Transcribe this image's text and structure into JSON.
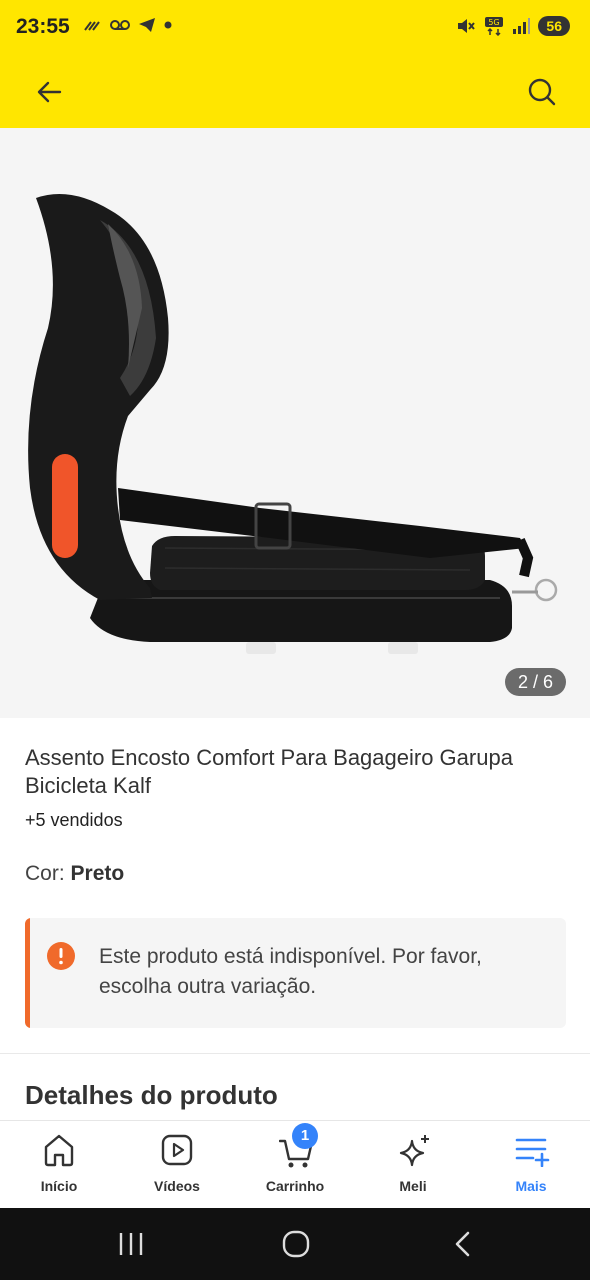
{
  "status_bar": {
    "time": "23:55",
    "battery": "56",
    "network": "5G",
    "colors": {
      "background": "#FFE600"
    },
    "icons": [
      "missed-call-icon",
      "voicemail-icon",
      "telegram-icon",
      "dot-icon",
      "mute-icon",
      "5g-icon",
      "signal-icon",
      "battery-icon"
    ]
  },
  "app_bar": {
    "icons": [
      "arrow-left-icon",
      "search-icon"
    ],
    "colors": {
      "background": "#FFE600"
    }
  },
  "gallery": {
    "page_indicator": "2 / 6"
  },
  "product": {
    "title": "Assento Encosto Comfort Para Bagageiro Garupa Bicicleta Kalf",
    "sold": "+5 vendidos",
    "color_label": "Cor: ",
    "color_value": "Preto"
  },
  "alert": {
    "message": "Este produto está indisponível. Por favor, escolha outra variação.",
    "colors": {
      "accent": "#F06A2B"
    }
  },
  "details": {
    "title": "Detalhes do produto"
  },
  "bottom_nav": {
    "items": [
      {
        "label": "Início",
        "icon": "home-icon"
      },
      {
        "label": "Vídeos",
        "icon": "video-icon"
      },
      {
        "label": "Carrinho",
        "icon": "cart-icon"
      },
      {
        "label": "Meli",
        "icon": "sparkle-icon"
      },
      {
        "label": "Mais",
        "icon": "menu-plus-icon"
      }
    ],
    "cart_badge": "1",
    "colors": {
      "active": "#3483FA"
    }
  }
}
